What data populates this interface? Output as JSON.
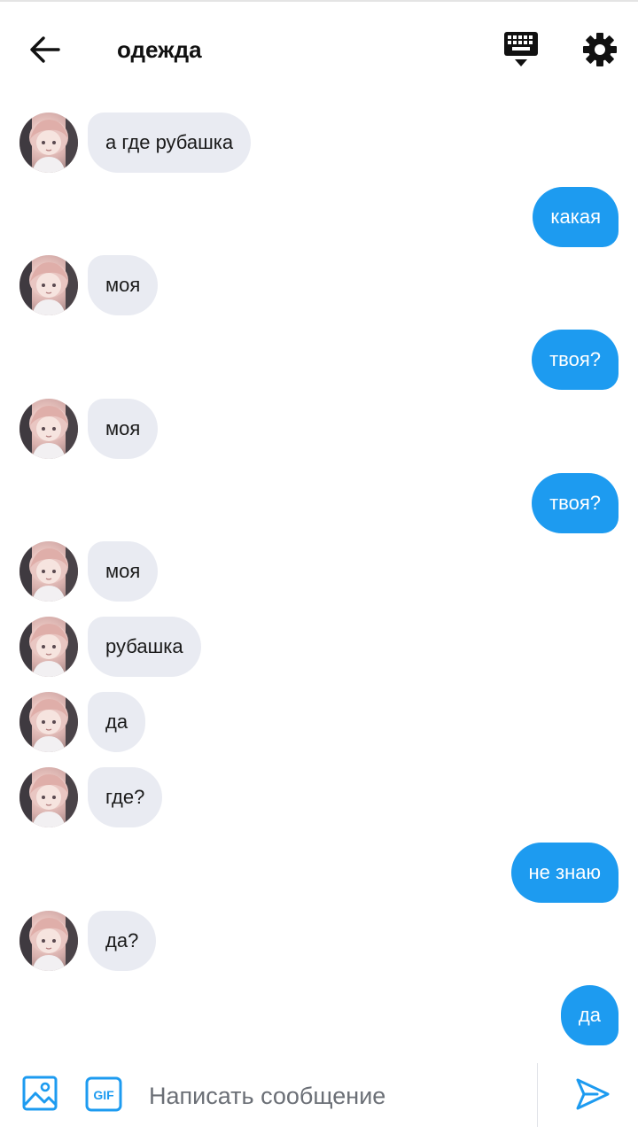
{
  "header": {
    "title": "одежда",
    "back_icon": "arrow-left-icon",
    "keyboard_icon": "keyboard-icon",
    "settings_icon": "gear-icon"
  },
  "messages": [
    {
      "side": "in",
      "text": "а где рубашка"
    },
    {
      "side": "out",
      "text": "какая"
    },
    {
      "side": "in",
      "text": "моя"
    },
    {
      "side": "out",
      "text": "твоя?"
    },
    {
      "side": "in",
      "text": "моя"
    },
    {
      "side": "out",
      "text": "твоя?"
    },
    {
      "side": "in",
      "text": "моя"
    },
    {
      "side": "in",
      "text": "рубашка"
    },
    {
      "side": "in",
      "text": "да"
    },
    {
      "side": "in",
      "text": "где?"
    },
    {
      "side": "out",
      "text": "не знаю"
    },
    {
      "side": "in",
      "text": "да?"
    },
    {
      "side": "out",
      "text": "да"
    }
  ],
  "composer": {
    "placeholder": "Написать сообщение",
    "gif_label": "GIF",
    "image_icon": "image-icon",
    "send_icon": "send-icon"
  },
  "colors": {
    "outgoing_bubble": "#1d9bf0",
    "incoming_bubble": "#e9ebf2",
    "accent": "#1d9bf0"
  }
}
